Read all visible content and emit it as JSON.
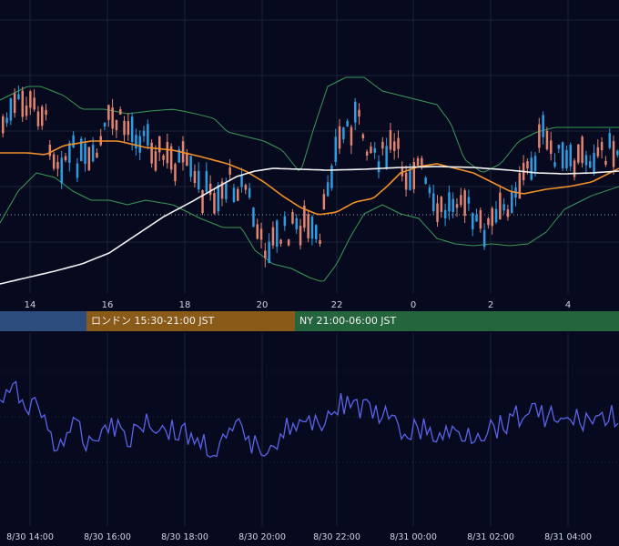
{
  "colors": {
    "background": "#070a1e",
    "grid": "#1c2238",
    "candle_up": "#2d9ce0",
    "candle_down": "#e28470",
    "bollinger": "#3a9a55",
    "ma_short": "#f0902a",
    "ma_long": "#f2f2f2",
    "oscillator": "#5a63e8",
    "session_tokyo": "#2c4d7d",
    "session_london": "#8a5a18",
    "session_ny": "#25653e"
  },
  "sessions": [
    {
      "label": "",
      "color": "#2c4d7d"
    },
    {
      "label": "ロンドン 15:30-21:00 JST",
      "color": "#8a5a18"
    },
    {
      "label": "NY 21:00-06:00 JST",
      "color": "#25653e"
    }
  ],
  "time_axis": [
    "8/30 14:00",
    "8/30 16:00",
    "8/30 18:00",
    "8/30 20:00",
    "8/30 22:00",
    "8/31 00:00",
    "8/31 02:00",
    "8/31 04:00"
  ],
  "chart_data": [
    {
      "type": "candlestick",
      "x_ticks": [
        "14",
        "16",
        "18",
        "20",
        "22",
        "0",
        "2",
        "4"
      ],
      "hour_range": [
        13.2,
        5.2
      ],
      "grid": true,
      "ylim": [
        0,
        100
      ],
      "reference_level": 30,
      "indicators": [
        "bollinger_bands",
        "moving_average_short",
        "moving_average_long"
      ]
    },
    {
      "type": "line",
      "ylim": [
        0,
        100
      ],
      "grid": true
    }
  ]
}
